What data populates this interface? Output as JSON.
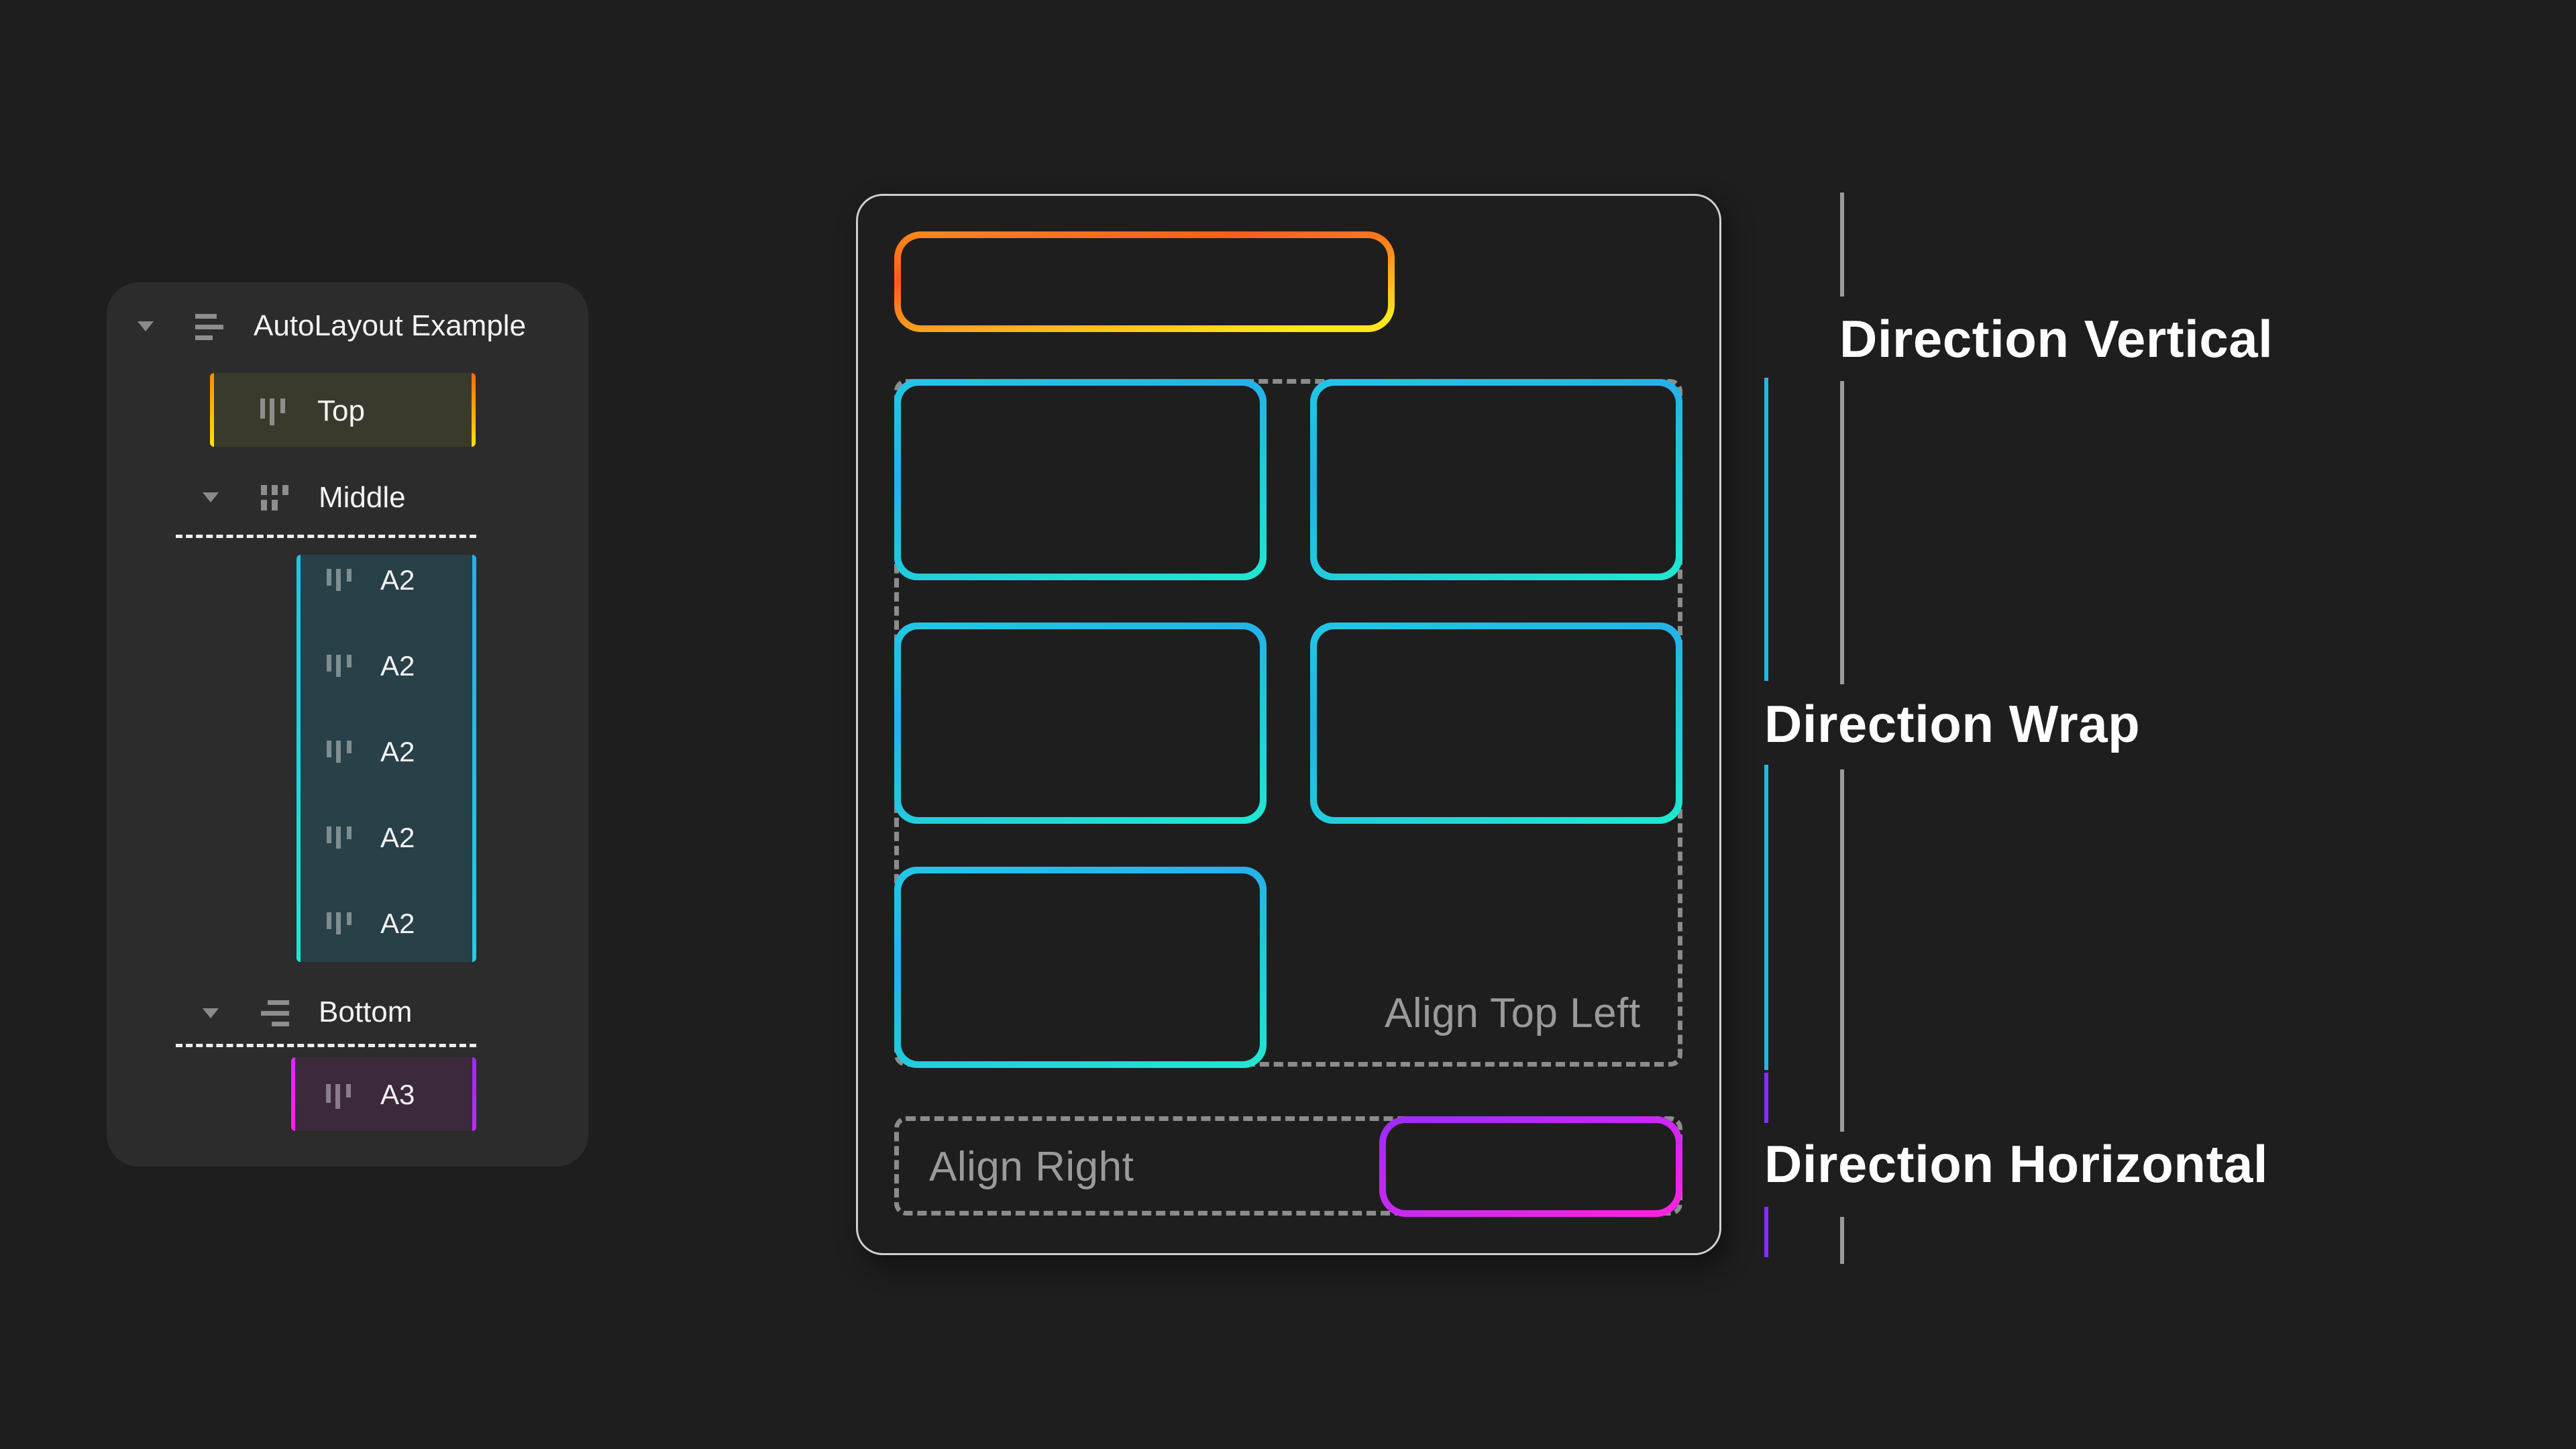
{
  "layers_panel": {
    "root": {
      "label": "AutoLayout Example",
      "icon": "align-left-lines-icon",
      "expanded": true
    },
    "top": {
      "label": "Top",
      "icon": "columns-icon",
      "accent_from": "#ff8a00",
      "accent_to": "#ffe600",
      "bg": "#3a3a2c"
    },
    "middle": {
      "label": "Middle",
      "icon": "grid-wrap-icon",
      "expanded": true,
      "children": [
        {
          "label": "A2",
          "icon": "columns-icon"
        },
        {
          "label": "A2",
          "icon": "columns-icon"
        },
        {
          "label": "A2",
          "icon": "columns-icon"
        },
        {
          "label": "A2",
          "icon": "columns-icon"
        },
        {
          "label": "A2",
          "icon": "columns-icon"
        }
      ],
      "accent_from": "#1ee8d2",
      "accent_to": "#23b0e8",
      "bg": "#284047"
    },
    "bottom": {
      "label": "Bottom",
      "icon": "align-right-lines-icon",
      "expanded": true,
      "children": [
        {
          "label": "A3",
          "icon": "columns-icon"
        }
      ],
      "accent_from": "#ff2ad8",
      "accent_to": "#9a2aff",
      "bg": "#3c2a3c"
    }
  },
  "frame": {
    "wrap_hint": "Align Top Left",
    "bottom_hint": "Align Right",
    "colors": {
      "top_gradient": [
        "#ff5a1f",
        "#ffe61a"
      ],
      "wrap_gradient": [
        "#20e8d0",
        "#25aee8"
      ],
      "bottom_gradient": [
        "#ff22e0",
        "#9b2cff"
      ],
      "dash": "#8c8c8c",
      "frame_border": "#cfcfcf"
    },
    "wrap_items": 5
  },
  "annotations": [
    {
      "label": "Direction Vertical",
      "color": "#9a9a9a"
    },
    {
      "label": "Direction Wrap",
      "color": "#27b4ec"
    },
    {
      "label": "Direction Horizontal",
      "color": "#8a2cff"
    }
  ]
}
